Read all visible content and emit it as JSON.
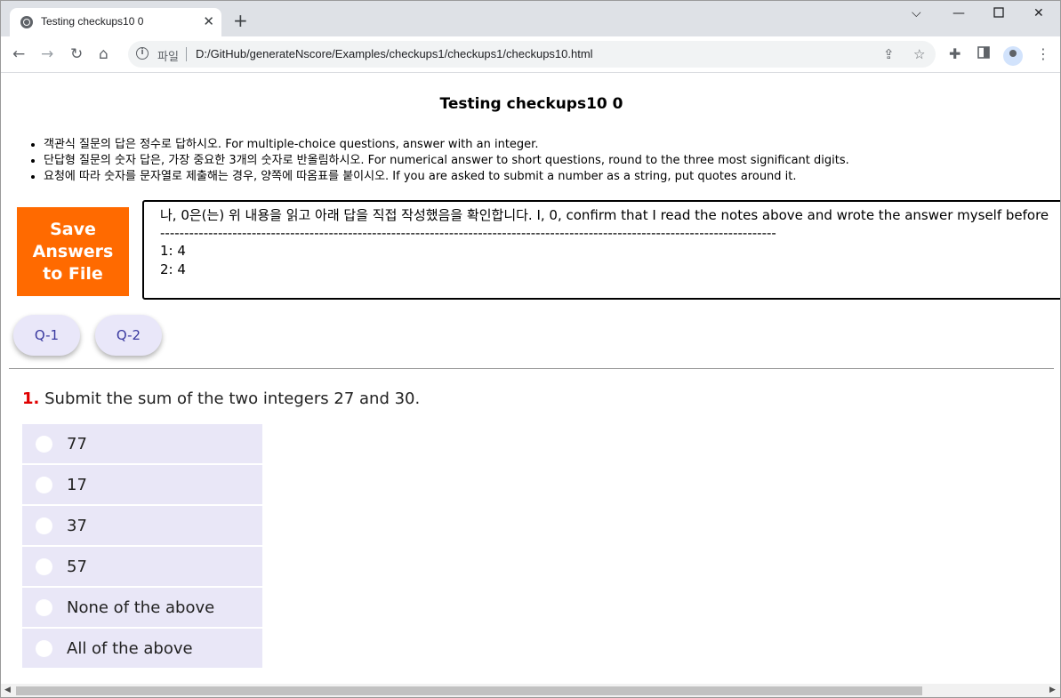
{
  "browser": {
    "tab_title": "Testing checkups10 0",
    "tab_close": "✕",
    "new_tab": "+",
    "url_scheme": "파일",
    "url": "D:/GitHub/generateNscore/Examples/checkups1/checkups1/checkups10.html",
    "icons": [
      "back-icon",
      "forward-icon",
      "reload-icon",
      "home-icon",
      "info-icon",
      "share-icon",
      "star-icon",
      "extensions-icon",
      "side-panel-icon",
      "profile-icon",
      "menu-icon",
      "minimize-icon",
      "maximize-icon",
      "close-icon"
    ]
  },
  "page": {
    "title": "Testing checkups10 0",
    "notes": [
      "객관식 질문의 답은 정수로 답하시오. For multiple-choice questions, answer with an integer.",
      "단답형 질문의 숫자 답은, 가장 중요한 3개의 숫자로 반올림하시오. For numerical answer to short questions, round to the three most significant digits.",
      "요청에 따라 숫자를 문자열로 제출해는 경우, 양쪽에 따옴표를 붙이시오. If you are asked to submit a number as a string, put quotes around it."
    ],
    "save_button": {
      "line1": "Save",
      "line2": "Answers",
      "line3": "to File"
    },
    "answer_box": {
      "confirm": "나, 0은(는) 위 내용을 읽고 아래 답을 직접 작성했음을 확인합니다. I, 0, confirm that I read the notes above and wrote the answer myself before",
      "separator": "--------------------------------------------------------------------------------------------------------------------------------",
      "answers": [
        "1: 4",
        "2: 4"
      ]
    },
    "question_nav": [
      "Q-1",
      "Q-2"
    ],
    "question": {
      "number": "1.",
      "text": "Submit the sum of the two integers 27 and 30.",
      "options": [
        "77",
        "17",
        "37",
        "57",
        "None of the above",
        "All of the above"
      ]
    }
  },
  "colors": {
    "save_button": "#ff6a00",
    "option_bg": "#e9e7f7",
    "question_number": "#e00000",
    "nav_button_bg": "#e9e7f9"
  }
}
